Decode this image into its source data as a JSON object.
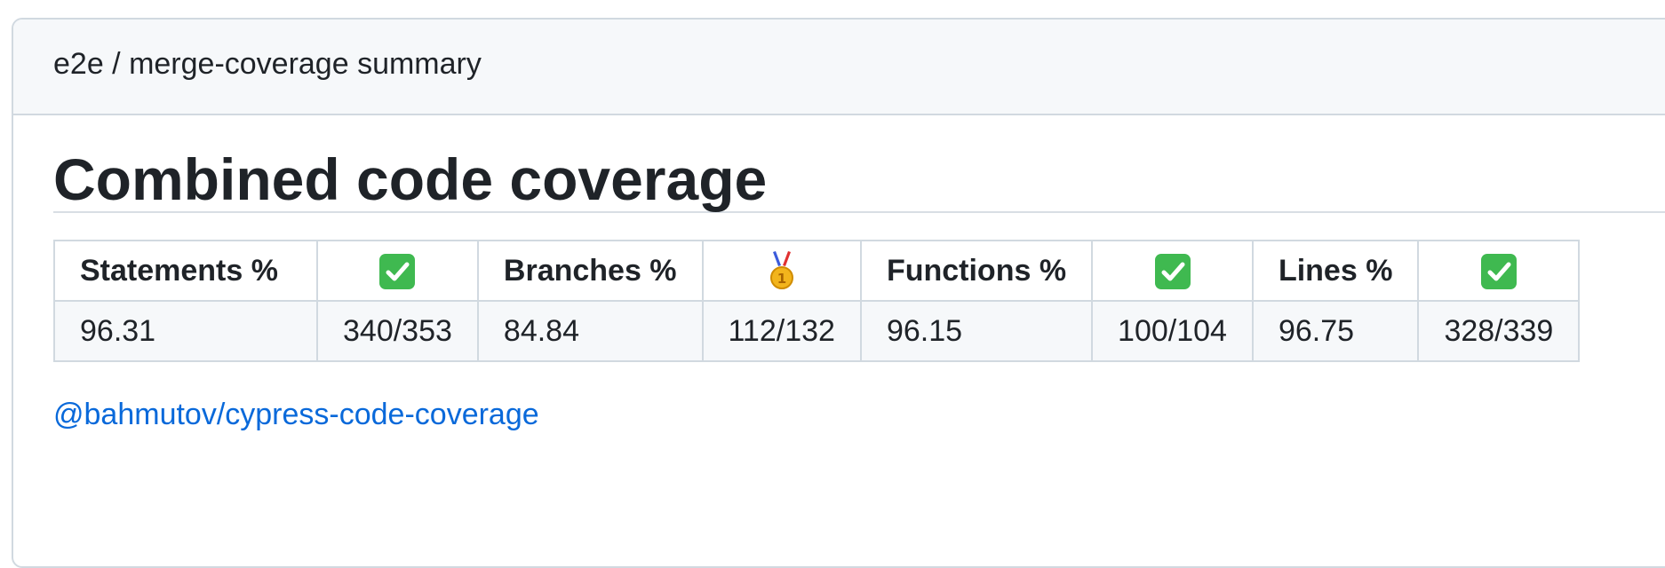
{
  "summary": {
    "title": "e2e / merge-coverage summary"
  },
  "report": {
    "heading": "Combined code coverage",
    "columns": [
      {
        "label": "Statements %",
        "status_icon": "check-mark-icon"
      },
      {
        "label": "Branches %",
        "status_icon": "first-place-medal-icon"
      },
      {
        "label": "Functions %",
        "status_icon": "check-mark-icon"
      },
      {
        "label": "Lines %",
        "status_icon": "check-mark-icon"
      }
    ],
    "values": {
      "statements_pct": "96.31",
      "statements_count": "340/353",
      "branches_pct": "84.84",
      "branches_count": "112/132",
      "functions_pct": "96.15",
      "functions_count": "100/104",
      "lines_pct": "96.75",
      "lines_count": "328/339"
    },
    "credit_link": "@bahmutov/cypress-code-coverage"
  },
  "colors": {
    "check_green": "#3fb950",
    "link_blue": "#0969da",
    "medal_gold": "#f2b41c"
  }
}
